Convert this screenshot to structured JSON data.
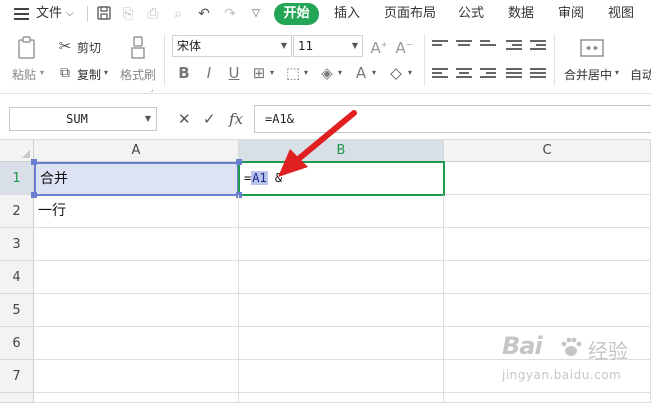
{
  "menubar": {
    "file_label": "文件",
    "tabs": [
      {
        "label": "开始",
        "active": true
      },
      {
        "label": "插入"
      },
      {
        "label": "页面布局"
      },
      {
        "label": "公式"
      },
      {
        "label": "数据"
      },
      {
        "label": "审阅"
      },
      {
        "label": "视图"
      }
    ]
  },
  "ribbon": {
    "paste_label": "粘贴",
    "cut_label": "剪切",
    "copy_label": "复制",
    "format_painter_label": "格式刷",
    "font_name": "宋体",
    "font_size": "11",
    "merge_center_label": "合并居中",
    "auto_label": "自动"
  },
  "formula_bar": {
    "name_box": "SUM",
    "fx_label": "fx",
    "formula": "=A1&"
  },
  "grid": {
    "columns": [
      "A",
      "B",
      "C"
    ],
    "rows": [
      "1",
      "2",
      "3",
      "4",
      "5",
      "6",
      "7"
    ],
    "cells": {
      "A1": "合并",
      "A2": "一行",
      "B1_prefix": "=",
      "B1_ref": "A1",
      "B1_suffix": "&"
    }
  },
  "colors": {
    "accent_green": "#22a655",
    "reference_blue": "#6b7fd0",
    "arrow_red": "#e02020"
  },
  "watermark": {
    "logo_text": "Bai",
    "logo_cn": "经验",
    "url": "jingyan.baidu.com"
  }
}
